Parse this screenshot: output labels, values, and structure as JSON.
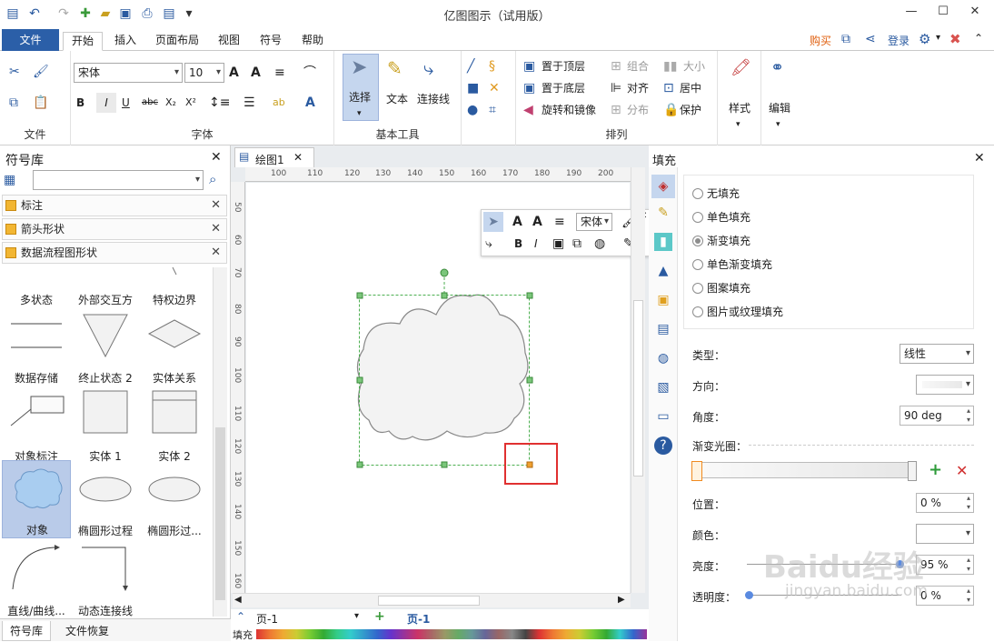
{
  "window": {
    "title": "亿图图示（试用版）"
  },
  "tabs": {
    "file": "文件",
    "items": [
      "开始",
      "插入",
      "页面布局",
      "视图",
      "符号",
      "帮助"
    ]
  },
  "account": {
    "buy": "购买",
    "login": "登录"
  },
  "ribbon": {
    "groups": {
      "file": "文件",
      "font": "字体",
      "basic_tools": "基本工具",
      "arrange": "排列"
    },
    "font_name": "宋体",
    "font_size": "10",
    "tools": {
      "select": "选择",
      "text": "文本",
      "connector": "连接线"
    },
    "arrange_items": [
      "置于顶层",
      "置于底层",
      "旋转和镜像",
      "组合",
      "对齐",
      "分布",
      "大小",
      "居中",
      "保护"
    ],
    "style": "样式",
    "edit": "编辑"
  },
  "library": {
    "title": "符号库",
    "sections": [
      "标注",
      "箭头形状",
      "数据流程图形状"
    ],
    "shapes": [
      "多状态",
      "外部交互方",
      "特权边界",
      "数据存储",
      "终止状态 2",
      "实体关系",
      "对象标注",
      "实体 1",
      "实体 2",
      "对象",
      "椭圆形过程",
      "椭圆形过...",
      "直线/曲线...",
      "动态连接线"
    ],
    "bottom_tabs": [
      "符号库",
      "文件恢复"
    ]
  },
  "document": {
    "tab": "绘图1",
    "page_tab": "页-1",
    "page_select": "页-1",
    "fill_label": "填充"
  },
  "ruler": {
    "h": [
      "100",
      "110",
      "120",
      "130",
      "140",
      "150",
      "160",
      "170",
      "180",
      "190",
      "200"
    ],
    "v": [
      "50",
      "60",
      "70",
      "80",
      "90",
      "100",
      "110",
      "120",
      "130",
      "140",
      "150",
      "160"
    ]
  },
  "floating_toolbar": {
    "font": "宋体"
  },
  "fill_panel": {
    "title": "填充",
    "options": [
      "无填充",
      "单色填充",
      "渐变填充",
      "单色渐变填充",
      "图案填充",
      "图片或纹理填充"
    ],
    "selected": "渐变填充",
    "type_label": "类型：",
    "type_value": "线性",
    "direction_label": "方向：",
    "angle_label": "角度：",
    "angle_value": "90 deg",
    "stops_label": "渐变光圈：",
    "position_label": "位置：",
    "position_value": "0 %",
    "color_label": "颜色：",
    "brightness_label": "亮度：",
    "brightness_value": "95 %",
    "transparency_label": "透明度：",
    "transparency_value": "0 %"
  },
  "watermark": {
    "text": "Baidu经验",
    "url": "jingyan.baidu.com"
  },
  "colors": {
    "accent": "#2b5fa8",
    "selection": "#b9cbe9",
    "highlight": "#e03030",
    "handle": "#57b847"
  }
}
